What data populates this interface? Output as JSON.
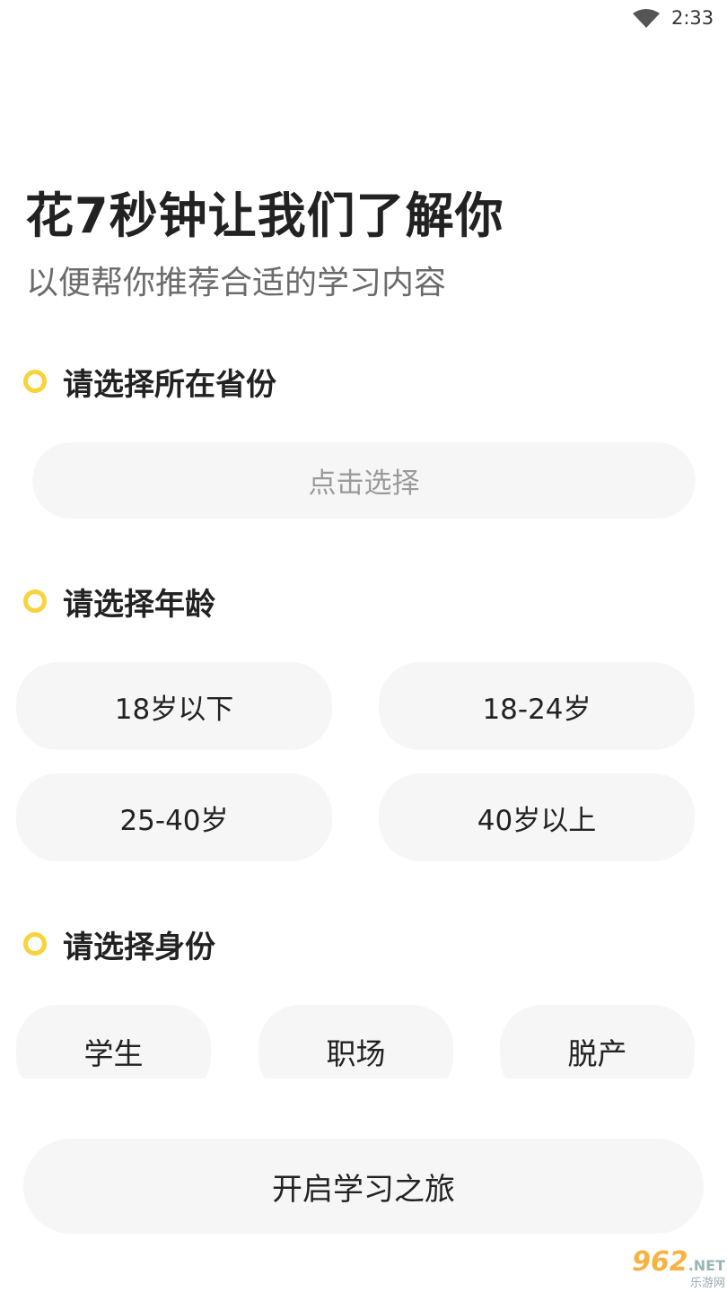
{
  "status_bar": {
    "time": "2:33",
    "wifi_icon": "wifi-icon"
  },
  "header": {
    "title": "花7秒钟让我们了解你",
    "subtitle": "以便帮你推荐合适的学习内容"
  },
  "province_section": {
    "label": "请选择所在省份",
    "select_placeholder": "点击选择"
  },
  "age_section": {
    "label": "请选择年龄",
    "options": [
      "18岁以下",
      "18-24岁",
      "25-40岁",
      "40岁以上"
    ]
  },
  "identity_section": {
    "label": "请选择身份",
    "options": [
      "学生",
      "职场",
      "脱产"
    ]
  },
  "start_button": {
    "label": "开启学习之旅"
  },
  "watermark": {
    "brand": "962",
    "tld": ".NET",
    "sub": "乐游网"
  },
  "colors": {
    "accent": "#f7d33c",
    "pill_bg": "#f6f6f6"
  }
}
